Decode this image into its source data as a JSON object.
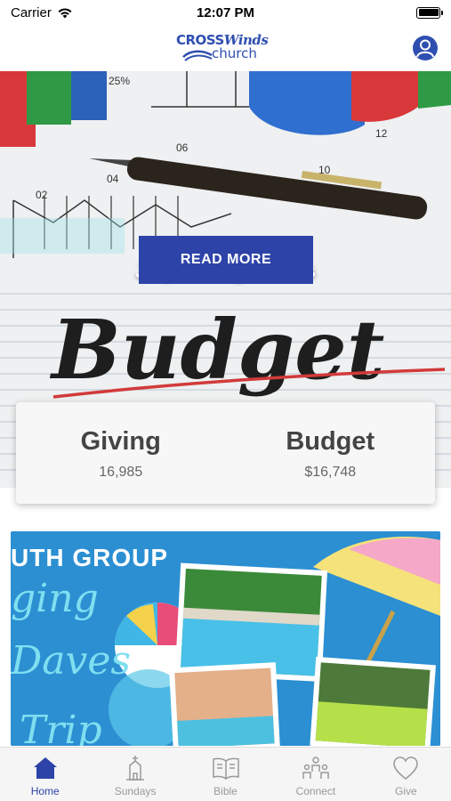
{
  "status_bar": {
    "carrier": "Carrier",
    "time": "12:07 PM",
    "battery_level": 1.0
  },
  "header": {
    "logo_top_plain": "CROSS",
    "logo_top_italic": "Winds",
    "logo_bottom": "church",
    "profile_icon": "user-icon"
  },
  "hero": {
    "title": "July's Budget Stats",
    "button_label": "READ MORE",
    "art_text": {
      "word": "Budget",
      "pct": "25%",
      "tick_02": "02",
      "tick_04": "04",
      "tick_06": "06",
      "tick_10": "10",
      "tick_12": "12"
    }
  },
  "stats": {
    "giving_label": "Giving",
    "giving_value": "16,985",
    "budget_label": "Budget",
    "budget_value": "$16,748"
  },
  "youth_banner": {
    "title": "UTH GROUP",
    "script_1": "ging",
    "script_2": "Daves",
    "script_3": "Trip"
  },
  "tabs": [
    {
      "label": "Home",
      "icon": "home-icon",
      "active": true
    },
    {
      "label": "Sundays",
      "icon": "church-icon",
      "active": false
    },
    {
      "label": "Bible",
      "icon": "book-icon",
      "active": false
    },
    {
      "label": "Connect",
      "icon": "people-icon",
      "active": false
    },
    {
      "label": "Give",
      "icon": "heart-icon",
      "active": false
    }
  ],
  "colors": {
    "brand": "#2d43a8",
    "tab_inactive": "#999999",
    "youth_bg": "#2b8fd2"
  }
}
